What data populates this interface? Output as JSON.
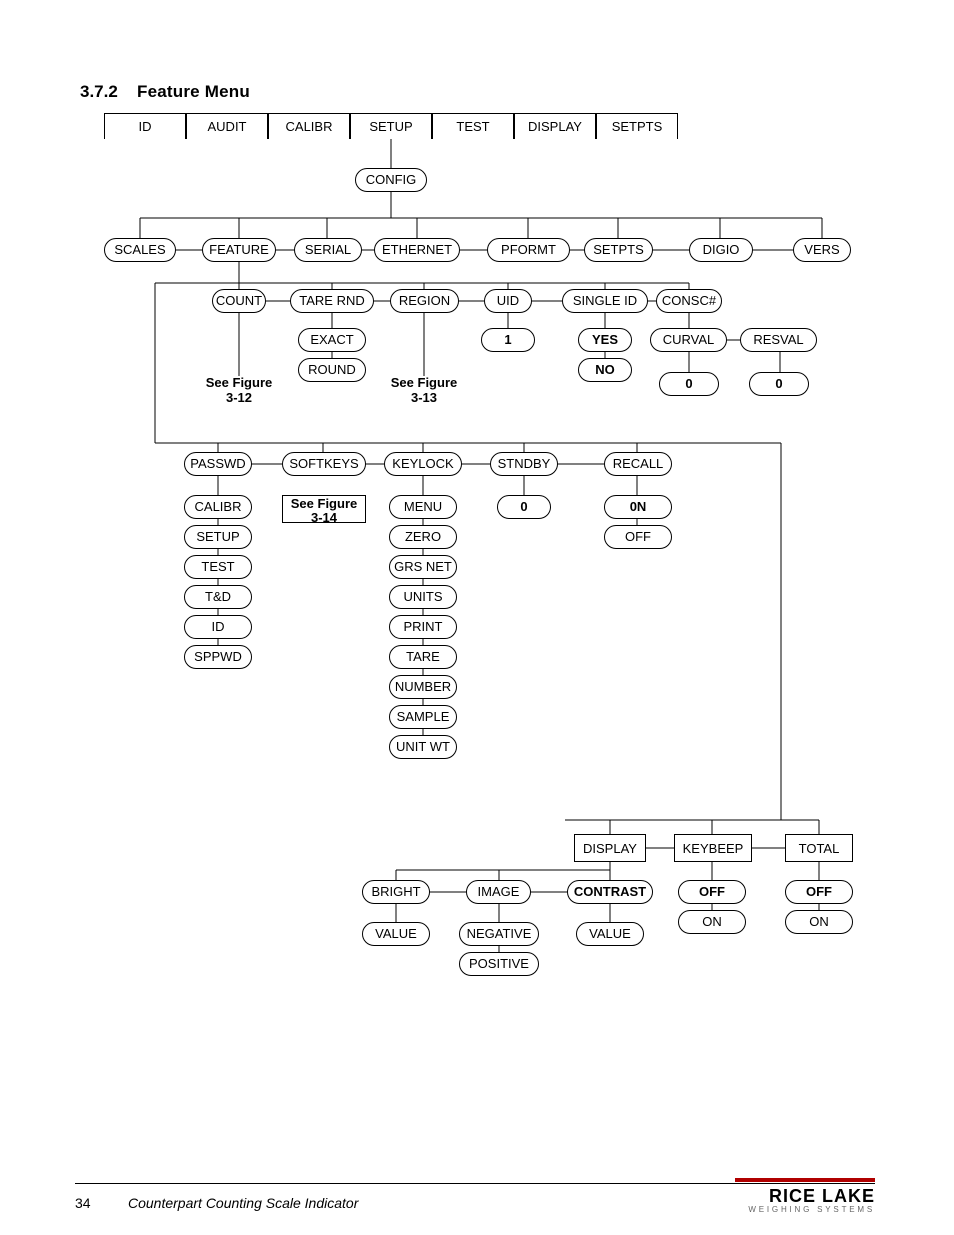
{
  "heading": {
    "num": "3.7.2",
    "title": "Feature Menu"
  },
  "footer": {
    "page": "34",
    "title": "Counterpart Counting Scale Indicator",
    "brand": "RICE LAKE",
    "brandsub": "WEIGHING SYSTEMS"
  },
  "tabs": [
    "ID",
    "AUDIT",
    "CALIBR",
    "SETUP",
    "TEST",
    "DISPLAY",
    "SETPTS"
  ],
  "config": "CONFIG",
  "row_config": [
    "SCALES",
    "FEATURE",
    "SERIAL",
    "ETHERNET",
    "PFORMT",
    "SETPTS",
    "DIGIO",
    "VERS"
  ],
  "row_feature": [
    "COUNT",
    "TARE RND",
    "REGION",
    "UID",
    "SINGLE ID",
    "CONSC#"
  ],
  "tarernd": [
    "EXACT",
    "ROUND"
  ],
  "uid_val": "1",
  "singleid": [
    "YES",
    "NO"
  ],
  "consc": [
    "CURVAL",
    "RESVAL"
  ],
  "consc_vals": [
    "0",
    "0"
  ],
  "note312": "See Figure\n3-12",
  "note313": "See Figure\n3-13",
  "row_feature2": [
    "PASSWD",
    "SOFTKEYS",
    "KEYLOCK",
    "STNDBY",
    "RECALL"
  ],
  "passwd": [
    "CALIBR",
    "SETUP",
    "TEST",
    "T&D",
    "ID",
    "SPPWD"
  ],
  "softkeys_note": "See Figure\n3-14",
  "keylock": [
    "MENU",
    "ZERO",
    "GRS NET",
    "UNITS",
    "PRINT",
    "TARE",
    "NUMBER",
    "SAMPLE",
    "UNIT WT"
  ],
  "stndby_val": "0",
  "recall": [
    "0N",
    "OFF"
  ],
  "row_display": [
    "DISPLAY",
    "KEYBEEP",
    "TOTAL"
  ],
  "disp_sub": [
    "BRIGHT",
    "IMAGE",
    "CONTRAST"
  ],
  "bright_val": "VALUE",
  "image": [
    "NEGATIVE",
    "POSITIVE"
  ],
  "contrast_val": "VALUE",
  "keybeep": [
    "OFF",
    "ON"
  ],
  "total": [
    "OFF",
    "ON"
  ]
}
